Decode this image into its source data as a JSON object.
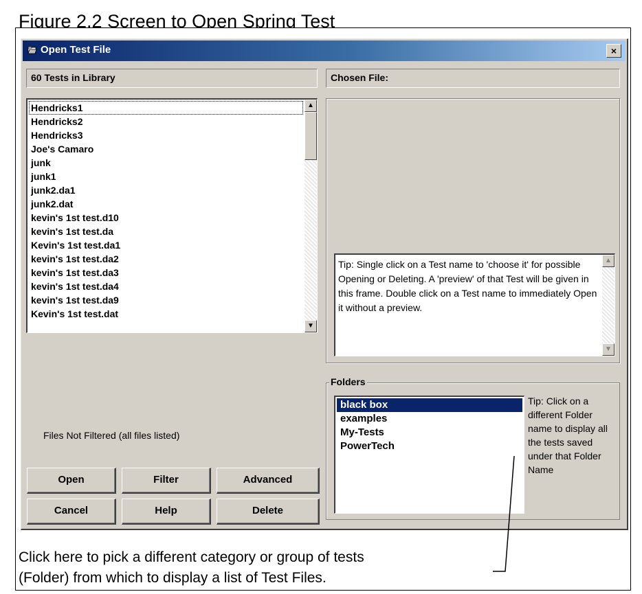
{
  "figure": {
    "title": "Figure 2.2  Screen to Open Spring Test",
    "caption_line1": "Click here to pick a different  category  or group of tests",
    "caption_line2": "(Folder) from which to display a list of Test Files."
  },
  "dialog": {
    "title": "Open Test File",
    "close_label": "×",
    "library_count_label": "60 Tests in Library",
    "chosen_file_label": "Chosen File:",
    "tip_text": "Tip: Single click on a Test name to 'choose it' for possible Opening or Deleting. A 'preview' of that Test will be given in this frame.  Double click on a Test name to immediately Open it without a preview.",
    "filter_status": "Files Not Filtered (all files listed)",
    "tests": [
      "Hendricks1",
      "Hendricks2",
      "Hendricks3",
      "Joe's Camaro",
      "junk",
      "junk1",
      "junk2.da1",
      "junk2.dat",
      "kevin's 1st test.d10",
      "kevin's 1st test.da",
      "Kevin's 1st test.da1",
      "kevin's 1st test.da2",
      "kevin's 1st test.da3",
      "kevin's 1st test.da4",
      "kevin's 1st test.da9",
      "Kevin's 1st test.dat"
    ],
    "folders": {
      "legend": "Folders",
      "items": [
        "black box",
        "examples",
        "My-Tests",
        "PowerTech"
      ],
      "selected": "black box",
      "tip": "Tip:  Click on a different Folder name to display all the tests saved under that Folder Name"
    },
    "buttons": {
      "open": "Open",
      "filter": "Filter",
      "advanced": "Advanced",
      "cancel": "Cancel",
      "help": "Help",
      "delete": "Delete"
    },
    "scroll": {
      "up_arrow": "▲",
      "down_arrow": "▼"
    },
    "colors": {
      "title_gradient_start": "#0a246a",
      "title_gradient_end": "#a6caf0",
      "dialog_face": "#d4d0c8",
      "selection": "#0a246a"
    }
  }
}
